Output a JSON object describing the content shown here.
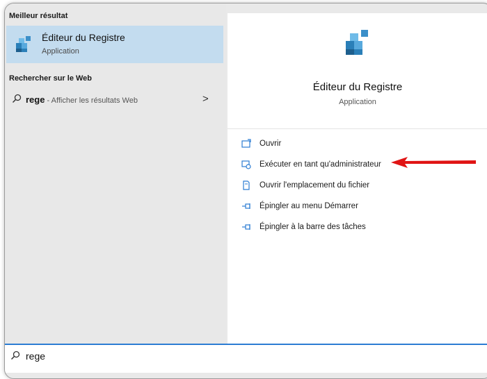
{
  "left": {
    "best_match_header": "Meilleur résultat",
    "best_match": {
      "title": "Éditeur du Registre",
      "subtitle": "Application",
      "icon": "registry-editor-icon"
    },
    "web_header": "Rechercher sur le Web",
    "web_result": {
      "query": "rege",
      "separator": " - ",
      "hint": "Afficher les résultats Web",
      "chevron": ">"
    }
  },
  "right": {
    "app_title": "Éditeur du Registre",
    "app_type": "Application",
    "actions": [
      {
        "label": "Ouvrir",
        "icon": "open-window-icon"
      },
      {
        "label": "Exécuter en tant qu'administrateur",
        "icon": "run-as-admin-icon"
      },
      {
        "label": "Ouvrir l'emplacement du fichier",
        "icon": "file-location-icon"
      },
      {
        "label": "Épingler au menu Démarrer",
        "icon": "pin-icon"
      },
      {
        "label": "Épingler à la barre des tâches",
        "icon": "pin-icon"
      }
    ]
  },
  "search": {
    "value": "rege"
  },
  "colors": {
    "accent": "#2b7cd3",
    "selection": "#c3dcef",
    "arrow": "#e01414"
  }
}
